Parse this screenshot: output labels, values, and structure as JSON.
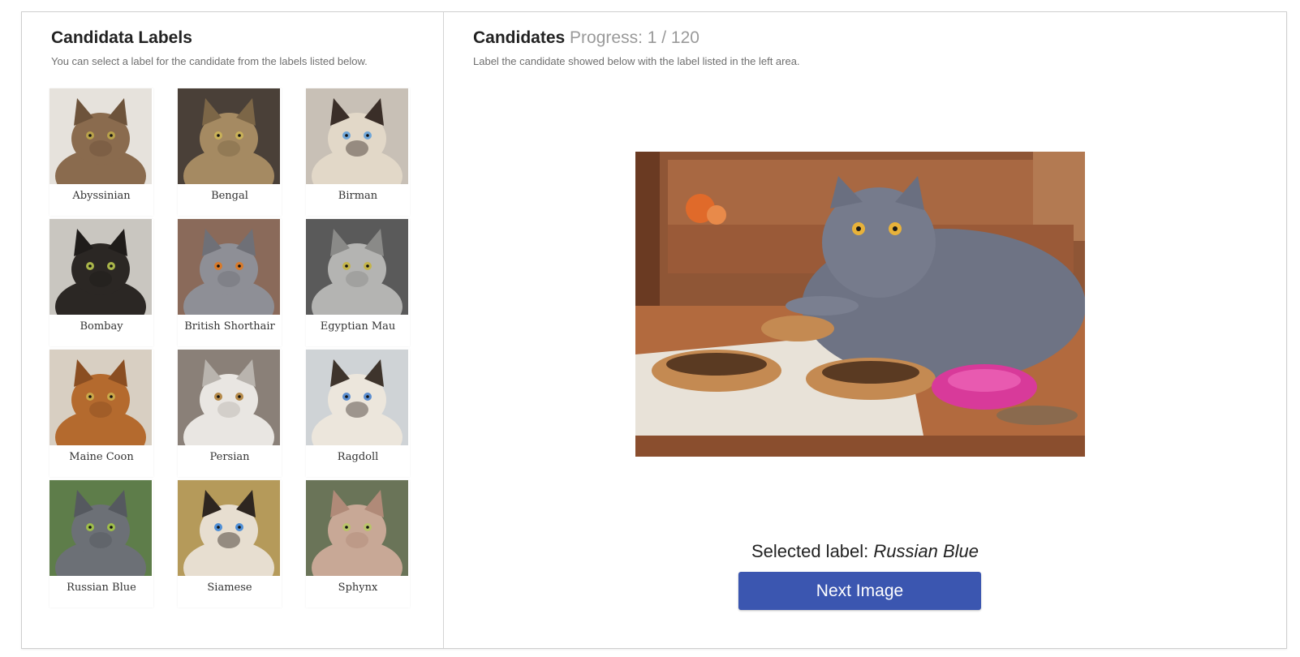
{
  "left_panel": {
    "title": "Candidata Labels",
    "subtitle": "You can select a label for the candidate from the labels listed below.",
    "labels": [
      {
        "name": "Abyssinian",
        "icon": "cat-photo",
        "bg": "#e6e2dc",
        "fur": "#8a6b4e",
        "ear": "#6d533b",
        "eye": "#b8a24a"
      },
      {
        "name": "Bengal",
        "icon": "cat-photo",
        "bg": "#4a4038",
        "fur": "#a58a62",
        "ear": "#7c6647",
        "eye": "#c9b158"
      },
      {
        "name": "Birman",
        "icon": "cat-photo",
        "bg": "#c8c0b6",
        "fur": "#e2d8c8",
        "ear": "#3a2e28",
        "eye": "#6fa6d8"
      },
      {
        "name": "Bombay",
        "icon": "cat-photo",
        "bg": "#c9c6c0",
        "fur": "#2b2724",
        "ear": "#1f1c1a",
        "eye": "#a9b54a"
      },
      {
        "name": "British Shorthair",
        "icon": "cat-photo",
        "bg": "#8a6a5a",
        "fur": "#8e8f96",
        "ear": "#6f7077",
        "eye": "#d87a2a"
      },
      {
        "name": "Egyptian Mau",
        "icon": "cat-photo",
        "bg": "#5a5a5a",
        "fur": "#b4b4b2",
        "ear": "#8a8a88",
        "eye": "#c4b44a"
      },
      {
        "name": "Maine Coon",
        "icon": "cat-photo",
        "bg": "#d8cfc2",
        "fur": "#b46a2e",
        "ear": "#8a4e22",
        "eye": "#c9a84a"
      },
      {
        "name": "Persian",
        "icon": "cat-photo",
        "bg": "#8a8078",
        "fur": "#e9e6e2",
        "ear": "#b9b4ae",
        "eye": "#b58a4a"
      },
      {
        "name": "Ragdoll",
        "icon": "cat-photo",
        "bg": "#cfd3d6",
        "fur": "#ece6dc",
        "ear": "#3e342c",
        "eye": "#5c8ed0"
      },
      {
        "name": "Russian Blue",
        "icon": "cat-photo",
        "bg": "#5e7d4a",
        "fur": "#6c7076",
        "ear": "#55595f",
        "eye": "#9ebd4a"
      },
      {
        "name": "Siamese",
        "icon": "cat-photo",
        "bg": "#b59a5a",
        "fur": "#e7ded0",
        "ear": "#2e2620",
        "eye": "#4f8fd6"
      },
      {
        "name": "Sphynx",
        "icon": "cat-photo",
        "bg": "#6a7458",
        "fur": "#c8a896",
        "ear": "#b08a78",
        "eye": "#b9c46a"
      }
    ]
  },
  "right_panel": {
    "title": "Candidates",
    "progress": "Progress: 1 / 120",
    "subtitle": "Label the candidate showed below with the label listed in the left area.",
    "candidate_image": {
      "icon": "cat-on-shoes-photo"
    },
    "selected_label_prefix": "Selected label:",
    "selected_label_value": "Russian Blue",
    "next_button_label": "Next Image"
  },
  "colors": {
    "accent": "#3b56b0",
    "muted_text": "#9a9a9a"
  }
}
